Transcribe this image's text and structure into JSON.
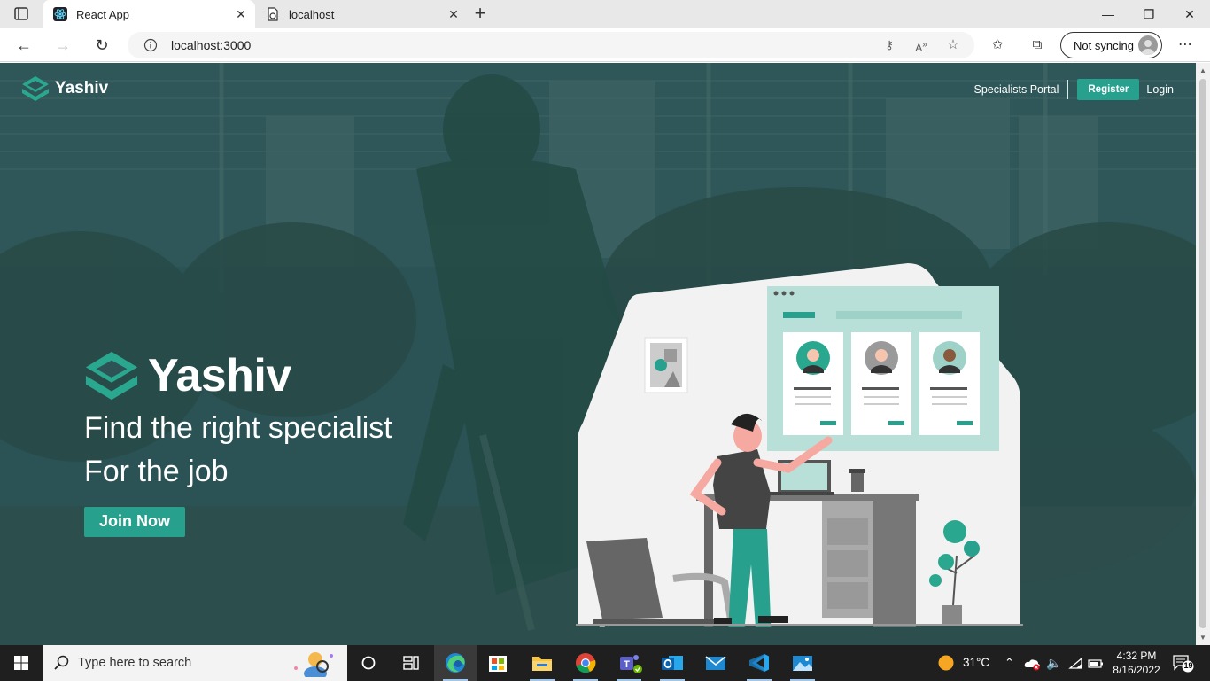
{
  "browser": {
    "tabs": [
      {
        "title": "React App",
        "active": true
      },
      {
        "title": "localhost",
        "active": false
      }
    ],
    "address": "localhost:3000",
    "sync_label": "Not syncing"
  },
  "page": {
    "header": {
      "brand": "Yashiv",
      "nav_specialists": "Specialists Portal",
      "nav_register": "Register",
      "nav_login": "Login"
    },
    "hero": {
      "brand": "Yashiv",
      "line1": "Find the right specialist",
      "line2": "For the job",
      "cta": "Join Now"
    },
    "colors": {
      "accent": "#27a08e",
      "overlay": "#2e5357"
    }
  },
  "taskbar": {
    "search_placeholder": "Type here to search",
    "temperature": "31°C",
    "time": "4:32 PM",
    "date": "8/16/2022",
    "notification_count": "19",
    "pinned_apps": [
      "task-view",
      "widgets",
      "edge",
      "store",
      "file-explorer",
      "chrome",
      "teams",
      "outlook",
      "mail",
      "vscode",
      "photos"
    ]
  }
}
